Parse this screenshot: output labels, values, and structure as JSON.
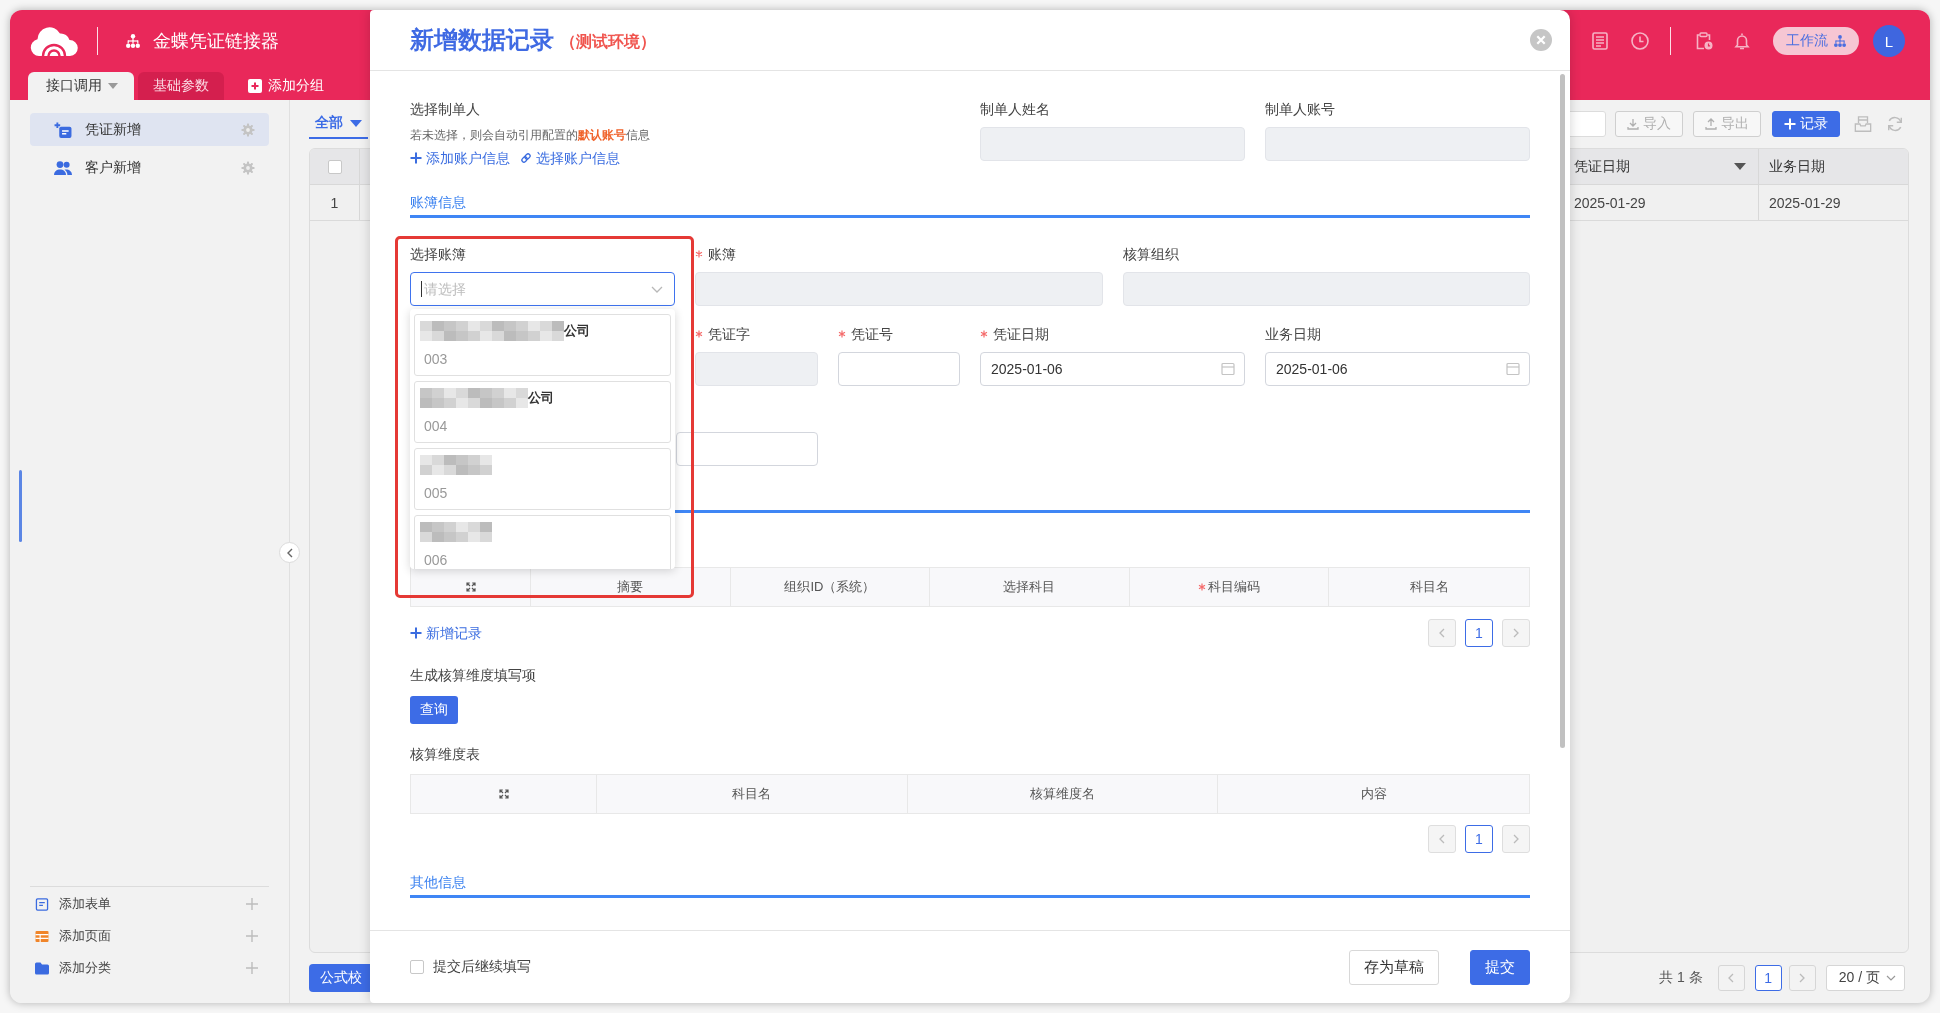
{
  "header": {
    "title": "金蝶凭证链接器",
    "tabs": [
      {
        "label": "接口调用",
        "selected": true,
        "dropdown": true
      },
      {
        "label": "基础参数",
        "selected": false,
        "dropdown": false
      }
    ],
    "add_group": "添加分组",
    "workflow": "工作流",
    "avatar": "L"
  },
  "sidebar": {
    "items": [
      {
        "label": "凭证新增",
        "selected": true
      },
      {
        "label": "客户新增",
        "selected": false
      }
    ],
    "actions": [
      "添加表单",
      "添加页面",
      "添加分类"
    ]
  },
  "main": {
    "filter_tab": {
      "label": "全部",
      "selected": true
    },
    "toolbar": [
      {
        "label": "导入",
        "kind": "import"
      },
      {
        "label": "导出",
        "kind": "export"
      },
      {
        "label": "记录",
        "kind": "create"
      }
    ],
    "table": {
      "select_all": false,
      "columns": [
        {
          "label": "凭证日期",
          "sorted": true
        },
        {
          "label": "业务日期",
          "sorted": false
        }
      ],
      "rows": [
        {
          "index": "1",
          "cells": [
            "2025-01-29",
            "2025-01-29"
          ]
        }
      ]
    },
    "formula_button": "公式校",
    "pagination": {
      "total": "共 1 条",
      "prev_disabled": true,
      "pages": [
        {
          "label": "1",
          "selected": true
        }
      ],
      "next_disabled": true,
      "page_size": "20 / 页"
    }
  },
  "modal": {
    "title": "新增数据记录",
    "env": "（测试环境）",
    "maker": {
      "label": "选择制单人",
      "hint": "若未选择，则会自动引用配置的**默认账号**信息",
      "links": [
        {
          "label": "添加账户信息",
          "kind": "add"
        },
        {
          "label": "选择账户信息",
          "kind": "link"
        }
      ]
    },
    "maker_fields": [
      {
        "kind": "text",
        "label": "制单人姓名",
        "required": false,
        "disabled": true
      },
      {
        "kind": "text",
        "label": "制单人账号",
        "required": false,
        "disabled": true
      }
    ],
    "ledger": {
      "title": "账簿信息",
      "fields": [
        {
          "kind": "select",
          "label": "选择账簿",
          "required": false,
          "placeholder": "请选择",
          "focused": true,
          "open": true,
          "highlighted": true,
          "options": [
            {
              "name": "公司",
              "code": "003",
              "redacted": true,
              "selected": false
            },
            {
              "name": "公司",
              "code": "004",
              "redacted": true,
              "selected": false
            },
            {
              "code": "005",
              "redacted": true,
              "selected": false
            },
            {
              "code": "006",
              "redacted": true,
              "selected": false
            }
          ]
        },
        {
          "kind": "text",
          "label": "账簿",
          "required": true,
          "disabled": true
        },
        {
          "kind": "text",
          "label": "核算组织",
          "required": false,
          "disabled": true
        },
        {
          "kind": "text",
          "label": "凭证字",
          "required": true,
          "disabled": true
        },
        {
          "kind": "text",
          "label": "凭证号",
          "required": true,
          "disabled": false
        },
        {
          "kind": "date",
          "label": "凭证日期",
          "required": true,
          "disabled": false,
          "value": "2025-01-06"
        },
        {
          "kind": "date",
          "label": "业务日期",
          "required": false,
          "disabled": false,
          "value": "2025-01-06"
        },
        {
          "kind": "text",
          "disabled": false
        }
      ]
    },
    "entries": {
      "columns": [
        {
          "label": "摘要",
          "required": false
        },
        {
          "label": "组织ID（系统）",
          "required": false
        },
        {
          "label": "选择科目",
          "required": false
        },
        {
          "label": "科目编码",
          "required": true
        },
        {
          "label": "科目名",
          "required": false
        }
      ],
      "add_link": "新增记录",
      "pagination": {
        "prev_disabled": true,
        "pages": [
          {
            "label": "1",
            "selected": true
          }
        ],
        "next_disabled": true
      }
    },
    "dimension": {
      "label": "生成核算维度填写项",
      "button": "查询",
      "table_label": "核算维度表",
      "columns": [
        {
          "label": "科目名"
        },
        {
          "label": "核算维度名"
        },
        {
          "label": "内容"
        }
      ],
      "pagination": {
        "prev_disabled": true,
        "pages": [
          {
            "label": "1",
            "selected": true
          }
        ],
        "next_disabled": true
      }
    },
    "other": {
      "title": "其他信息"
    },
    "footer": {
      "continue": {
        "label": "提交后继续填写",
        "checked": false
      },
      "buttons": [
        {
          "label": "存为草稿",
          "kind": "default"
        },
        {
          "label": "提交",
          "kind": "primary"
        }
      ]
    }
  }
}
